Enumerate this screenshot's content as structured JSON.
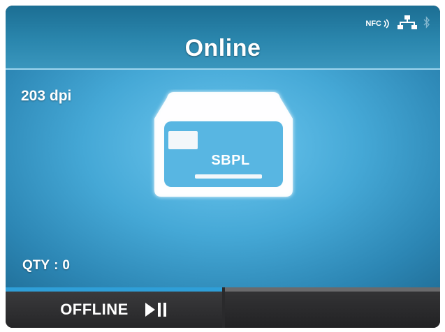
{
  "header": {
    "status_title": "Online",
    "nfc_label": "NFC",
    "icons": [
      "nfc-icon",
      "lan-icon",
      "bluetooth-icon"
    ]
  },
  "main": {
    "resolution": "203 dpi",
    "language": "SBPL",
    "qty_label": "QTY",
    "qty_separator": ":",
    "qty_value": "0"
  },
  "buttons": {
    "offline_label": "OFFLINE",
    "offline_icon": "play-pause-icon"
  },
  "colors": {
    "header_bg": "#2a86ad",
    "content_bg": "#45a8d6",
    "active_button_accent": "#2f9fd8",
    "inactive_button_accent": "#6a6a6c"
  }
}
